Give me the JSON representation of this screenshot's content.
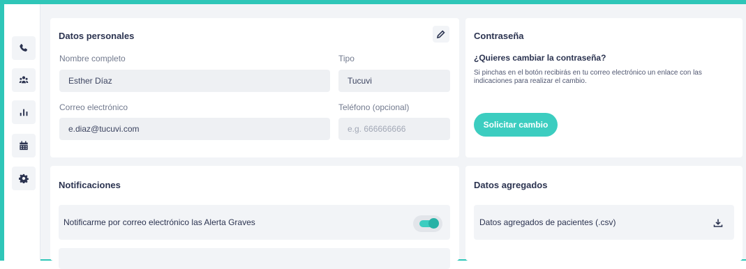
{
  "sidebar": {
    "items": [
      {
        "icon": "phone-icon"
      },
      {
        "icon": "users-icon"
      },
      {
        "icon": "bar-chart-icon"
      },
      {
        "icon": "calendar-icon"
      },
      {
        "icon": "gear-icon"
      }
    ]
  },
  "personal": {
    "title": "Datos personales",
    "name_label": "Nombre completo",
    "name_value": "Esther Díaz",
    "type_label": "Tipo",
    "type_value": "Tucuvi",
    "email_label": "Correo electrónico",
    "email_value": "e.diaz@tucuvi.com",
    "phone_label": "Teléfono (opcional)",
    "phone_placeholder": "e.g. 666666666"
  },
  "password": {
    "title": "Contraseña",
    "question": "¿Quieres cambiar la contraseña?",
    "description": "Si pinchas en el botón recibirás en tu correo electrónico un enlace con las indicaciones para realizar el cambio.",
    "button_label": "Solicitar cambio"
  },
  "notifications": {
    "title": "Notificaciones",
    "items": [
      {
        "label": "Notificarme por correo electrónico las Alerta Graves",
        "enabled": true
      }
    ]
  },
  "aggregated": {
    "title": "Datos agregados",
    "download_label": "Datos agregados de pacientes (.csv)"
  },
  "colors": {
    "accent": "#2fc6b8",
    "button": "#3ccdc0",
    "text": "#2b3350"
  }
}
